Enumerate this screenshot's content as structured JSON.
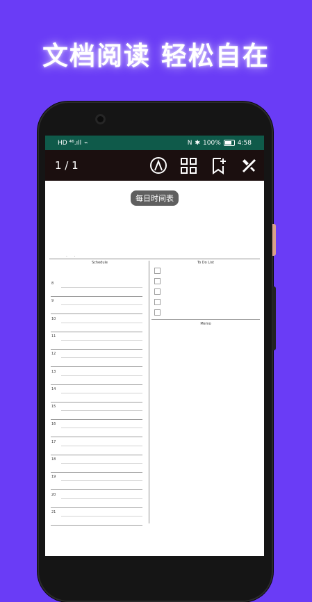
{
  "headline": "文档阅读 轻松自在",
  "status": {
    "left": "HD ⁴⁶.ıll",
    "right": "100%",
    "time": "4:58"
  },
  "toolbar": {
    "page_count": "1 / 1",
    "tools": [
      "pen-icon",
      "grid-icon",
      "bookmark-plus-icon",
      "tools-icon"
    ]
  },
  "document": {
    "title_badge": "每日时间表",
    "schedule_label": "Schedule",
    "todo_label": "To Do List",
    "memo_label": "Memo",
    "hours": [
      "8",
      "9",
      "10",
      "11",
      "12",
      "13",
      "14",
      "15",
      "16",
      "17",
      "18",
      "19",
      "20",
      "21"
    ]
  },
  "colors": {
    "background": "#6a3cf6",
    "statusbar": "#0f5a4a",
    "toolbar": "#1b0f0f"
  }
}
